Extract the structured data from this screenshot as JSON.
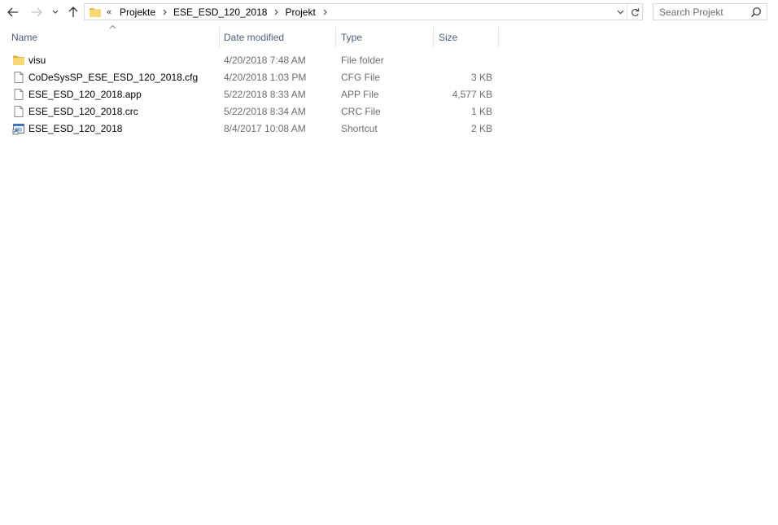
{
  "toolbar": {
    "back_icon": "arrow-left-icon",
    "forward_icon": "arrow-right-icon",
    "recent_icon": "chevron-down-icon",
    "up_icon": "arrow-up-icon",
    "address": {
      "overflow": "«",
      "breadcrumbs": [
        "Projekte",
        "ESE_ESD_120_2018",
        "Projekt"
      ]
    },
    "search_placeholder": "Search Projekt"
  },
  "columns": {
    "name": "Name",
    "date": "Date modified",
    "type": "Type",
    "size": "Size",
    "sorted_by": "Name"
  },
  "files": [
    {
      "name": "visu",
      "date": "4/20/2018 7:48 AM",
      "type": "File folder",
      "size": "",
      "icon": "folder-icon"
    },
    {
      "name": "CoDeSysSP_ESE_ESD_120_2018.cfg",
      "date": "4/20/2018 1:03 PM",
      "type": "CFG File",
      "size": "3 KB",
      "icon": "file-icon"
    },
    {
      "name": "ESE_ESD_120_2018.app",
      "date": "5/22/2018 8:33 AM",
      "type": "APP File",
      "size": "4,577 KB",
      "icon": "file-icon"
    },
    {
      "name": "ESE_ESD_120_2018.crc",
      "date": "5/22/2018 8:34 AM",
      "type": "CRC File",
      "size": "1 KB",
      "icon": "file-icon"
    },
    {
      "name": "ESE_ESD_120_2018",
      "date": "8/4/2017 10:08 AM",
      "type": "Shortcut",
      "size": "2 KB",
      "icon": "shortcut-icon"
    }
  ],
  "colors": {
    "folder": "#f8d775",
    "header_text": "#4c607a",
    "secondary_text": "#6d6d6d"
  }
}
